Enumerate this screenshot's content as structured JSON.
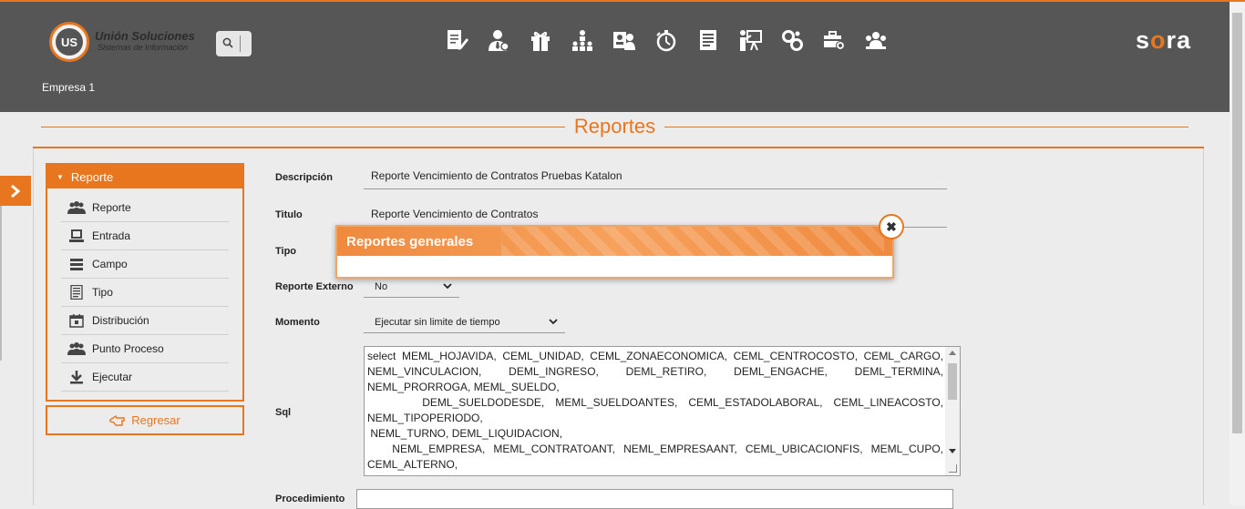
{
  "header": {
    "logo_text": "US",
    "brand_name": "Unión Soluciones",
    "brand_tagline": "Sistemas de Información",
    "empresa": "Empresa 1",
    "product": {
      "pre": "s",
      "o": "o",
      "post": "ra"
    },
    "nav_icons": [
      "edit-report-icon",
      "user-tie-icon",
      "gift-icon",
      "org-chart-icon",
      "user-card-icon",
      "stopwatch-icon",
      "document-list-icon",
      "presentation-icon",
      "gears-icon",
      "briefcase-settings-icon",
      "team-icon"
    ]
  },
  "page": {
    "title": "Reportes"
  },
  "menu": {
    "header": "Reporte",
    "items": [
      {
        "label": "Reporte",
        "icon": "users-icon"
      },
      {
        "label": "Entrada",
        "icon": "monitor-icon"
      },
      {
        "label": "Campo",
        "icon": "stack-icon"
      },
      {
        "label": "Tipo",
        "icon": "list-icon"
      },
      {
        "label": "Distribución",
        "icon": "calendar-icon"
      },
      {
        "label": "Punto Proceso",
        "icon": "users-icon"
      },
      {
        "label": "Ejecutar",
        "icon": "download-icon"
      }
    ],
    "back_label": "Regresar"
  },
  "form": {
    "descripcion_label": "Descripción",
    "descripcion_value": "Reporte Vencimiento de Contratos Pruebas Katalon",
    "titulo_label": "Titulo",
    "titulo_value": "Reporte Vencimiento de Contratos",
    "tipo_label": "Tipo",
    "externo_label": "Reporte Externo",
    "externo_value": "No",
    "momento_label": "Momento",
    "momento_value": "Ejecutar sin limite de tiempo",
    "sql_label": "Sql",
    "sql_value": "select MEML_HOJAVIDA, CEML_UNIDAD, CEML_ZONAECONOMICA, CEML_CENTROCOSTO, CEML_CARGO, NEML_VINCULACION, DEML_INGRESO, DEML_RETIRO, DEML_ENGACHE, DEML_TERMINA, NEML_PRORROGA, MEML_SUELDO,\n     DEML_SUELDODESDE, MEML_SUELDOANTES, CEML_ESTADOLABORAL, CEML_LINEACOSTO, NEML_TIPOPERIODO,\n NEML_TURNO, DEML_LIQUIDACION,\n   NEML_EMPRESA, MEML_CONTRATOANT, NEML_EMPRESAANT, CEML_UBICACIONFIS, MEML_CUPO, CEML_ALTERNO,",
    "procedimiento_label": "Procedimiento"
  },
  "modal": {
    "title": "Reportes generales",
    "close_glyph": "✖"
  },
  "colors": {
    "accent": "#e8761e",
    "header_bg": "#565656",
    "page_bg": "#ececec"
  }
}
